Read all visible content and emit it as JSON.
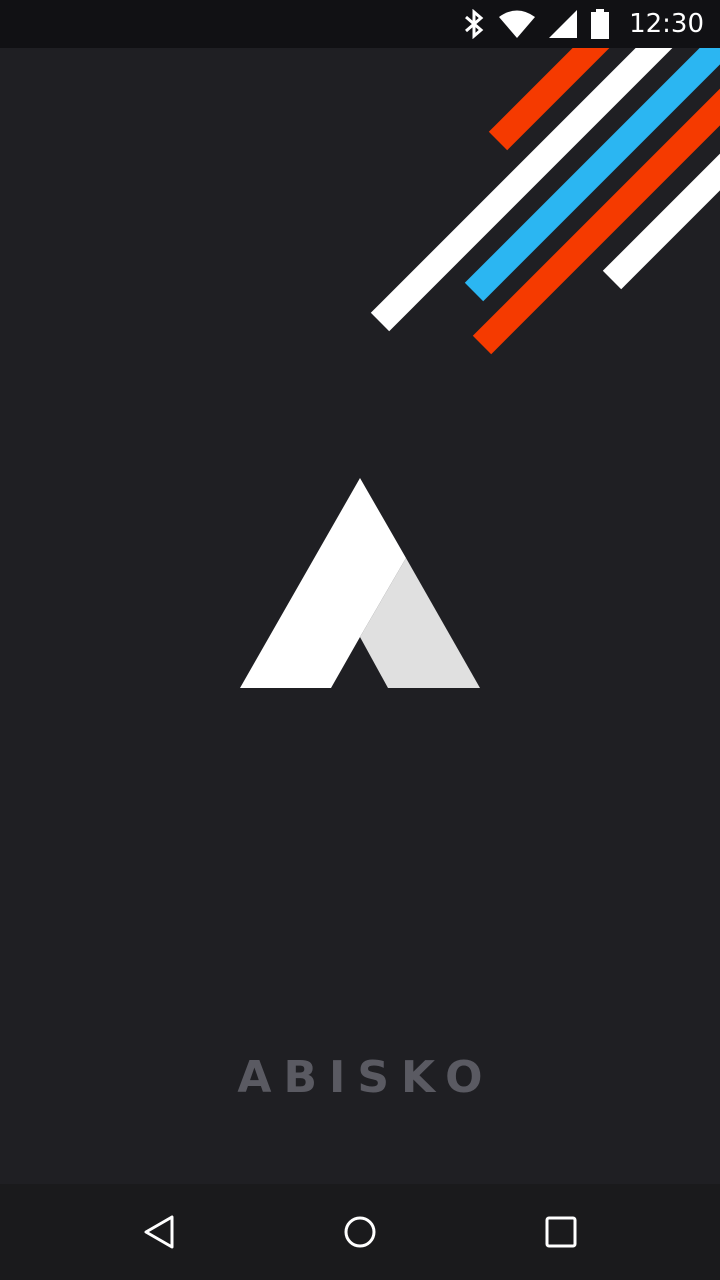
{
  "status_bar": {
    "time": "12:30",
    "icons": [
      "bluetooth-icon",
      "wifi-icon",
      "signal-icon",
      "battery-icon"
    ]
  },
  "app": {
    "brand_name": "ABISKO"
  },
  "decoration": {
    "stripe_colors": [
      "#f53a00",
      "#ffffff",
      "#2bb6f2"
    ]
  },
  "logo": {
    "icon": "abisko-logo-mountain",
    "colors": [
      "#ffffff",
      "#e0e0e0"
    ]
  },
  "nav_bar": {
    "buttons": [
      "back-icon",
      "home-icon",
      "recents-icon"
    ]
  }
}
